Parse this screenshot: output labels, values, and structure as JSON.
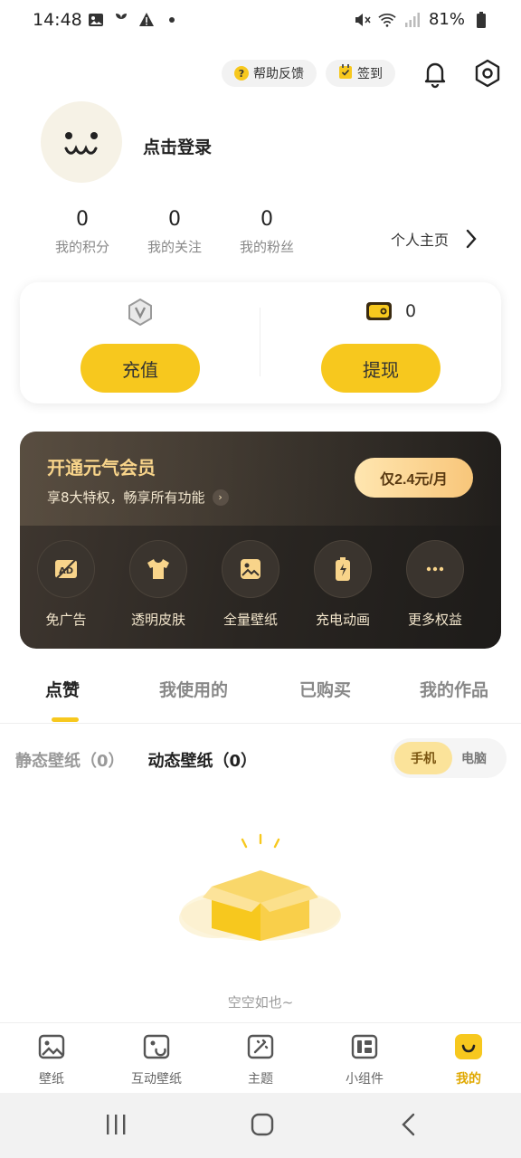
{
  "status_bar": {
    "time": "14:48",
    "battery": "81%"
  },
  "top_actions": {
    "help_label": "帮助反馈",
    "checkin_label": "签到"
  },
  "profile": {
    "login_text": "点击登录",
    "stats": [
      {
        "value": "0",
        "label": "我的积分"
      },
      {
        "value": "0",
        "label": "我的关注"
      },
      {
        "value": "0",
        "label": "我的粉丝"
      }
    ],
    "homepage_label": "个人主页"
  },
  "wallet": {
    "coin_balance": "0",
    "recharge_label": "充值",
    "withdraw_label": "提现"
  },
  "vip": {
    "title": "开通元气会员",
    "subtitle": "享8大特权，畅享所有功能",
    "price_button": "仅2.4元/月",
    "perks": [
      {
        "label": "免广告",
        "icon": "no-ads-icon"
      },
      {
        "label": "透明皮肤",
        "icon": "shirt-icon"
      },
      {
        "label": "全量壁纸",
        "icon": "image-icon"
      },
      {
        "label": "充电动画",
        "icon": "battery-charge-icon"
      },
      {
        "label": "更多权益",
        "icon": "more-icon"
      }
    ]
  },
  "tabs": [
    "点赞",
    "我使用的",
    "已购买",
    "我的作品"
  ],
  "subtabs": {
    "static": "静态壁纸（0）",
    "dynamic": "动态壁纸（0）"
  },
  "device_toggle": {
    "phone": "手机",
    "pc": "电脑"
  },
  "empty_text": "空空如也~",
  "bottom_nav": [
    {
      "label": "壁纸",
      "icon": "wallpaper-icon"
    },
    {
      "label": "互动壁纸",
      "icon": "interactive-wallpaper-icon"
    },
    {
      "label": "主题",
      "icon": "theme-icon"
    },
    {
      "label": "小组件",
      "icon": "widget-icon"
    },
    {
      "label": "我的",
      "icon": "me-icon"
    }
  ],
  "colors": {
    "accent": "#f7c81e",
    "vip_gold": "#f8d48a",
    "active_nav": "#e0a800"
  }
}
